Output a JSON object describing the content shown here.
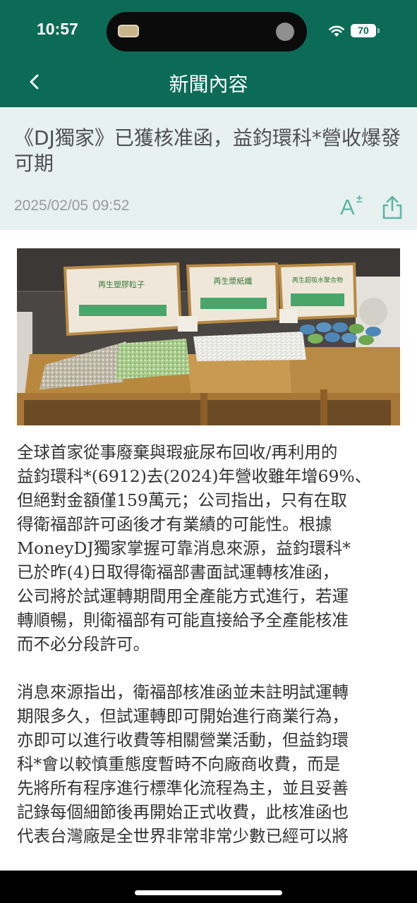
{
  "status_bar": {
    "time": "10:57",
    "battery": "70"
  },
  "nav": {
    "title": "新聞內容",
    "back_icon": "chevron-left-icon"
  },
  "article": {
    "headline": "《DJ獨家》已獲核准函，益鈞環科*營收爆發可期",
    "date": "2025/02/05 09:52",
    "font_size_label": "A",
    "font_size_symbol": "±",
    "photo": {
      "sign_left": "再生塑膠粒子",
      "sign_middle": "再生漿紙纖",
      "sign_right": "再生超吸水聚合物"
    },
    "paragraph1_lines": [
      "全球首家從事廢棄與瑕疵尿布回收/再利用的",
      "益鈞環科*(6912)去(2024)年營收雖年增69%、",
      "但絕對金額僅159萬元；公司指出，只有在取",
      "得衛福部許可函後才有業績的可能性。根據",
      "MoneyDJ獨家掌握可靠消息來源，益鈞環科*",
      "已於昨(4)日取得衛福部書面試運轉核准函，",
      "公司將於試運轉期間用全產能方式進行，若運",
      "轉順暢，則衛福部有可能直接給予全產能核准",
      "而不必分段許可。"
    ],
    "paragraph2_lines": [
      "消息來源指出，衛福部核准函並未註明試運轉",
      "期限多久，但試運轉即可開始進行商業行為，",
      "亦即可以進行收費等相關營業活動，但益鈞環",
      "科*會以較慎重態度暫時不向廠商收費，而是",
      "先將所有程序進行標準化流程為主，並且妥善",
      "記錄每個細節後再開始正式收費，此核准函也",
      "代表台灣廠是全世界非常非常少數已經可以將"
    ]
  },
  "colors": {
    "brand_green": "#0c6b57",
    "header_bg": "#e7f1ef",
    "accent_teal": "#5fb5a7"
  }
}
